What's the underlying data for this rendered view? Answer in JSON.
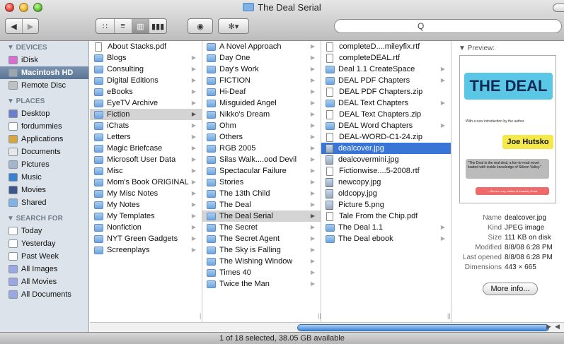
{
  "window": {
    "title": "The Deal Serial"
  },
  "toolbar": {
    "back": "◀",
    "forward": "▶",
    "view_icon": "∷",
    "view_list": "≡",
    "view_columns": "▥",
    "view_coverflow": "▮▮▮",
    "quicklook": "◉",
    "action": "✻▾"
  },
  "search": {
    "placeholder": "",
    "icon": "Q"
  },
  "sidebar": {
    "devices_header": "▼ DEVICES",
    "devices": [
      {
        "label": "iDisk",
        "icon": "idisk-icon",
        "color": "#d86fd0"
      },
      {
        "label": "Macintosh HD",
        "icon": "hard-drive-icon",
        "color": "#9aa5b0"
      },
      {
        "label": "Remote Disc",
        "icon": "remote-disc-icon",
        "color": "#c0c0c0"
      }
    ],
    "places_header": "▼ PLACES",
    "places": [
      {
        "label": "Desktop",
        "icon": "desktop-icon",
        "color": "#6a7fc7"
      },
      {
        "label": "fordummies",
        "icon": "home-icon",
        "color": "#ffffff"
      },
      {
        "label": "Applications",
        "icon": "applications-icon",
        "color": "#d9a540"
      },
      {
        "label": "Documents",
        "icon": "documents-icon",
        "color": "#e8e8e8"
      },
      {
        "label": "Pictures",
        "icon": "pictures-icon",
        "color": "#a4b7c9"
      },
      {
        "label": "Music",
        "icon": "music-icon",
        "color": "#3b7fd1"
      },
      {
        "label": "Movies",
        "icon": "movies-icon",
        "color": "#3e5588"
      },
      {
        "label": "Shared",
        "icon": "shared-folder-icon",
        "color": "#7fb2e5"
      }
    ],
    "search_header": "▼ SEARCH FOR",
    "search_items": [
      {
        "label": "Today",
        "icon": "clock-icon",
        "color": "#ffffff"
      },
      {
        "label": "Yesterday",
        "icon": "clock-icon",
        "color": "#ffffff"
      },
      {
        "label": "Past Week",
        "icon": "clock-icon",
        "color": "#ffffff"
      },
      {
        "label": "All Images",
        "icon": "smart-folder-icon",
        "color": "#9aa7e0"
      },
      {
        "label": "All Movies",
        "icon": "smart-folder-icon",
        "color": "#9aa7e0"
      },
      {
        "label": "All Documents",
        "icon": "smart-folder-icon",
        "color": "#9aa7e0"
      }
    ]
  },
  "columns": [
    {
      "items": [
        {
          "label": "About Stacks.pdf",
          "icon": "doc"
        },
        {
          "label": "Blogs",
          "icon": "folder"
        },
        {
          "label": "Consulting",
          "icon": "folder"
        },
        {
          "label": "Digital Editions",
          "icon": "folder"
        },
        {
          "label": "eBooks",
          "icon": "folder"
        },
        {
          "label": "EyeTV Archive",
          "icon": "folder"
        },
        {
          "label": "Fiction",
          "icon": "folder",
          "state": "hl"
        },
        {
          "label": "iChats",
          "icon": "folder"
        },
        {
          "label": "Letters",
          "icon": "folder"
        },
        {
          "label": "Magic Briefcase",
          "icon": "folder"
        },
        {
          "label": "Microsoft User Data",
          "icon": "folder"
        },
        {
          "label": "Misc",
          "icon": "folder"
        },
        {
          "label": "Mom's Book ORIGINAL",
          "icon": "folder"
        },
        {
          "label": "My Misc Notes",
          "icon": "folder"
        },
        {
          "label": "My Notes",
          "icon": "folder"
        },
        {
          "label": "My Templates",
          "icon": "folder"
        },
        {
          "label": "Nonfiction",
          "icon": "folder"
        },
        {
          "label": "NYT Green Gadgets",
          "icon": "folder"
        },
        {
          "label": "Screenplays",
          "icon": "folder"
        }
      ]
    },
    {
      "items": [
        {
          "label": "A Novel Approach",
          "icon": "folder"
        },
        {
          "label": "Day One",
          "icon": "folder"
        },
        {
          "label": "Day's Work",
          "icon": "folder"
        },
        {
          "label": "FICTION",
          "icon": "folder"
        },
        {
          "label": "Hi-Deaf",
          "icon": "folder"
        },
        {
          "label": "Misguided Angel",
          "icon": "folder"
        },
        {
          "label": "Nikko's Dream",
          "icon": "folder"
        },
        {
          "label": "Ohm",
          "icon": "folder"
        },
        {
          "label": "Others",
          "icon": "folder"
        },
        {
          "label": "RGB 2005",
          "icon": "folder"
        },
        {
          "label": "Silas Walk....ood Devil",
          "icon": "folder"
        },
        {
          "label": "Spectacular Failure",
          "icon": "folder"
        },
        {
          "label": "Stories",
          "icon": "folder"
        },
        {
          "label": "The 13th Child",
          "icon": "folder"
        },
        {
          "label": "The Deal",
          "icon": "folder"
        },
        {
          "label": "The Deal Serial",
          "icon": "folder",
          "state": "hl"
        },
        {
          "label": "The Secret",
          "icon": "folder"
        },
        {
          "label": "The Secret Agent",
          "icon": "folder"
        },
        {
          "label": "The Sky is Falling",
          "icon": "folder"
        },
        {
          "label": "The Wishing Window",
          "icon": "folder"
        },
        {
          "label": "Times 40",
          "icon": "folder"
        },
        {
          "label": "Twice the Man",
          "icon": "folder"
        }
      ]
    },
    {
      "items": [
        {
          "label": "completeD....mileyfix.rtf",
          "icon": "doc"
        },
        {
          "label": "completeDEAL.rtf",
          "icon": "doc"
        },
        {
          "label": "Deal 1.1 CreateSpace",
          "icon": "folder"
        },
        {
          "label": "DEAL PDF Chapters",
          "icon": "folder"
        },
        {
          "label": "DEAL PDF Chapters.zip",
          "icon": "doc"
        },
        {
          "label": "DEAL Text Chapters",
          "icon": "folder"
        },
        {
          "label": "DEAL Text Chapters.zip",
          "icon": "doc"
        },
        {
          "label": "DEAL Word Chapters",
          "icon": "folder"
        },
        {
          "label": "DEAL-WORD-C1-24.zip",
          "icon": "doc"
        },
        {
          "label": "dealcover.jpg",
          "icon": "img",
          "state": "bl"
        },
        {
          "label": "dealcovermini.jpg",
          "icon": "img"
        },
        {
          "label": "Fictionwise....5-2008.rtf",
          "icon": "doc"
        },
        {
          "label": "newcopy.jpg",
          "icon": "img"
        },
        {
          "label": "oldcopy.jpg",
          "icon": "img"
        },
        {
          "label": "Picture 5.png",
          "icon": "img"
        },
        {
          "label": "Tale From the Chip.pdf",
          "icon": "doc"
        },
        {
          "label": "The Deal 1.1",
          "icon": "folder"
        },
        {
          "label": "The Deal ebook",
          "icon": "folder"
        }
      ]
    }
  ],
  "preview": {
    "label": "▼ Preview:",
    "cover_title": "THE DEAL",
    "cover_sub": "With a new introduction by the author",
    "cover_author": "Joe Hutsko",
    "cover_quote": "\"The Deal is the real deal, a fun-to-read novel loaded with inside knowledge of Silicon Valley.\"",
    "cover_blurb": "—Steven Levy, author of Insanely Great",
    "info": [
      {
        "k": "Name",
        "v": "dealcover.jpg"
      },
      {
        "k": "Kind",
        "v": "JPEG image"
      },
      {
        "k": "Size",
        "v": "111 KB on disk"
      },
      {
        "k": "Modified",
        "v": "8/8/08 6:28 PM"
      },
      {
        "k": "Last opened",
        "v": "8/8/08 6:28 PM"
      },
      {
        "k": "Dimensions",
        "v": "443 × 665"
      }
    ],
    "more_button": "More info..."
  },
  "status": {
    "text": "1 of 18 selected, 38.05 GB available"
  },
  "col_marks": [
    "||",
    "||",
    "||"
  ]
}
